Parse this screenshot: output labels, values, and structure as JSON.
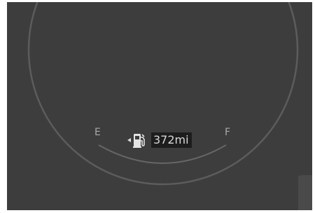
{
  "gauge": {
    "empty_label": "E",
    "full_label": "F",
    "range_value": "372mi",
    "fuel_pump_icon": "fuel-pump-icon",
    "side_indicator_icon": "left-triangle-icon"
  },
  "colors": {
    "panel_background": "#3d3d3d",
    "dial_ring": "#5a5a5a",
    "label_text": "#a9a9a9",
    "readout_background": "#1d1d1d",
    "readout_text": "#d8d8d8"
  }
}
